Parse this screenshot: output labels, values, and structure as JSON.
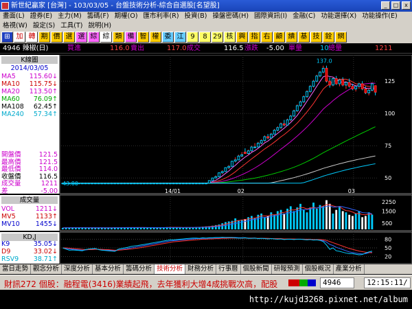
{
  "window": {
    "title": "新世紀贏家 [台灣] - 103/03/05 - 台盤技術分析-綜合自選股[名望股]",
    "min": "_",
    "max": "□",
    "close": "x"
  },
  "menu1": [
    "畫面(L)",
    "證券(E)",
    "主力(M)",
    "籌碼(F)",
    "期權(O)",
    "匯市利率(R)",
    "投資(B)",
    "操盤密碼(H)",
    "國際資訊(I)",
    "金融(C)",
    "功能選擇(X)",
    "功能操作(E)"
  ],
  "menu2": [
    "格視(W)",
    "設定(S)",
    "工具(T)",
    "說明(H)"
  ],
  "toolbar": [
    {
      "t": "⊞",
      "bg": "#2040c0",
      "fg": "#ffffff"
    },
    {
      "t": "加",
      "bg": "#ffffff",
      "fg": "#cc0000"
    },
    {
      "t": "轉",
      "bg": "#ffffff",
      "fg": "#cc0000"
    },
    {
      "t": "期",
      "bg": "#ffcc00",
      "fg": "#000000"
    },
    {
      "t": "價",
      "bg": "#ffcc00",
      "fg": "#000000"
    },
    {
      "t": "選",
      "bg": "#ffcc00",
      "fg": "#000000"
    },
    {
      "t": "選",
      "bg": "#ff66ff",
      "fg": "#000000"
    },
    {
      "t": "綜",
      "bg": "#ff66ff",
      "fg": "#000000"
    },
    {
      "t": "綜",
      "bg": "#ffffff",
      "fg": "#000000"
    },
    {
      "t": "類",
      "bg": "#ffcc00",
      "fg": "#000000"
    },
    {
      "t": "備",
      "bg": "#ff66ff",
      "fg": "#000000"
    },
    {
      "t": "智",
      "bg": "#ffcc00",
      "fg": "#000000"
    },
    {
      "t": "權",
      "bg": "#ffcc00",
      "fg": "#000000"
    },
    {
      "t": "委",
      "bg": "#66ccff",
      "fg": "#000000"
    },
    {
      "t": "江",
      "bg": "#66ccff",
      "fg": "#000000"
    },
    {
      "t": "9",
      "bg": "#ffff66",
      "fg": "#000000"
    },
    {
      "t": "8",
      "bg": "#ffff66",
      "fg": "#000000"
    },
    {
      "t": "29",
      "bg": "#ffff66",
      "fg": "#000000"
    },
    {
      "t": "核",
      "bg": "#ffff66",
      "fg": "#000000"
    },
    {
      "t": "興",
      "bg": "#ffcc00",
      "fg": "#000000"
    },
    {
      "t": "指",
      "bg": "#ffcc00",
      "fg": "#000000"
    },
    {
      "t": "右",
      "bg": "#ffcc00",
      "fg": "#000000"
    },
    {
      "t": "顧",
      "bg": "#ffcc00",
      "fg": "#000000"
    },
    {
      "t": "績",
      "bg": "#ffcc00",
      "fg": "#000000"
    },
    {
      "t": "基",
      "bg": "#ffcc00",
      "fg": "#000000"
    },
    {
      "t": "技",
      "bg": "#ffcc00",
      "fg": "#000000"
    },
    {
      "t": "銓",
      "bg": "#ffcc00",
      "fg": "#000000"
    },
    {
      "t": "網",
      "bg": "#ffcc00",
      "fg": "#000000"
    }
  ],
  "info": {
    "code": "4946 辣椒(日)",
    "buy_label": "買進",
    "buy": "116.0",
    "sell_label": "賣出",
    "sell": "117.0",
    "deal_label": "成交",
    "deal": "116.5",
    "chg_label": "漲跌",
    "chg": "-5.00",
    "vol_label": "單量",
    "vol": "10",
    "total_label": "總量",
    "total": "1211"
  },
  "kpanel": {
    "header": "K線圖",
    "date": "2014/03/05",
    "ma": [
      {
        "n": "MA5",
        "v": "115.60",
        "c": "#cc00cc",
        "a": "↓"
      },
      {
        "n": "MA10",
        "v": "115.75",
        "c": "#cc0000",
        "a": "↓"
      },
      {
        "n": "MA20",
        "v": "113.50",
        "c": "#cc00cc",
        "a": "↑"
      },
      {
        "n": "MA60",
        "v": "76.09",
        "c": "#00aa00",
        "a": "↑"
      },
      {
        "n": "MA108",
        "v": "62.45",
        "c": "#000000",
        "a": "↑"
      },
      {
        "n": "MA240",
        "v": "57.34",
        "c": "#00aacc",
        "a": "↑"
      }
    ],
    "ohlc": [
      {
        "n": "開盤價",
        "v": "121.5",
        "c": "#cc00cc"
      },
      {
        "n": "最高價",
        "v": "121.5",
        "c": "#cc00cc"
      },
      {
        "n": "最低價",
        "v": "114.0",
        "c": "#cc00cc"
      },
      {
        "n": "收盤價",
        "v": "116.5",
        "c": "#000000"
      },
      {
        "n": "成交量",
        "v": "1211",
        "c": "#cc00cc"
      },
      {
        "n": "差",
        "v": "-5.00",
        "c": "#cc00cc"
      }
    ]
  },
  "vpanel": {
    "header": "成交量",
    "rows": [
      {
        "n": "VOL",
        "v": "1211",
        "c": "#cc00cc",
        "a": "↓"
      },
      {
        "n": "MV5",
        "v": "1133",
        "c": "#cc0000",
        "a": "↑"
      },
      {
        "n": "MV10",
        "v": "1455",
        "c": "#0000cc",
        "a": "↓"
      }
    ]
  },
  "kdpanel": {
    "header": "KD,J",
    "rows": [
      {
        "n": "K9",
        "v": "35.05",
        "c": "#0000cc",
        "a": "↓"
      },
      {
        "n": "D9",
        "v": "33.02",
        "c": "#cc0000",
        "a": "↓"
      },
      {
        "n": "RSV9",
        "v": "38.71",
        "c": "#00aacc",
        "a": "↑"
      }
    ]
  },
  "chart_data": {
    "type": "candlestick",
    "price_axis": [
      125,
      100,
      75,
      50
    ],
    "vol_axis": [
      2250,
      1500,
      500
    ],
    "kd_axis": [
      80,
      50,
      20
    ],
    "x_labels": [
      "14/01",
      "02",
      "03"
    ],
    "high_label": "137.0",
    "low_label": "43.80",
    "candles": [
      [
        46,
        46.5,
        45.5,
        46
      ],
      [
        46,
        46.5,
        45.5,
        46
      ],
      [
        46,
        46.5,
        45.5,
        46
      ],
      [
        46,
        46.5,
        45.5,
        46
      ],
      [
        46,
        46.5,
        45.5,
        46
      ],
      [
        46,
        46.5,
        45.5,
        46
      ],
      [
        46,
        46.5,
        45.5,
        46
      ],
      [
        46,
        46.5,
        45.5,
        46
      ],
      [
        46,
        46.5,
        45.5,
        46
      ],
      [
        46,
        46.5,
        45.5,
        46
      ],
      [
        46,
        46.5,
        45.5,
        46
      ],
      [
        46,
        46.5,
        45.5,
        46
      ],
      [
        46,
        46.5,
        45.5,
        46
      ],
      [
        46,
        46.5,
        45.5,
        46
      ],
      [
        46,
        46.5,
        45.5,
        46
      ],
      [
        46,
        46.5,
        45.5,
        46
      ],
      [
        46,
        46.5,
        45.5,
        46
      ],
      [
        46,
        46.5,
        45.5,
        46
      ],
      [
        46,
        46.5,
        45.5,
        46
      ],
      [
        46,
        46.5,
        45.5,
        46
      ],
      [
        46,
        46.5,
        45.5,
        46
      ],
      [
        46,
        46.5,
        45.5,
        46
      ],
      [
        46,
        46.5,
        45.5,
        46
      ],
      [
        46,
        46.5,
        45.5,
        46
      ],
      [
        46,
        46.5,
        45.5,
        46
      ],
      [
        46,
        46.5,
        45.5,
        46
      ],
      [
        46,
        46.5,
        45.5,
        46
      ],
      [
        46,
        46.5,
        45.5,
        46
      ],
      [
        46,
        46.5,
        45.5,
        46
      ],
      [
        46,
        46.5,
        45.5,
        46
      ],
      [
        46,
        46.5,
        45.5,
        46
      ],
      [
        46,
        46.5,
        45.5,
        46
      ],
      [
        46,
        46.5,
        45.5,
        46
      ],
      [
        46,
        46.5,
        45.5,
        46
      ],
      [
        46,
        46.5,
        45.5,
        46
      ],
      [
        46,
        46.5,
        45.5,
        46
      ],
      [
        46,
        46.5,
        45.5,
        46
      ],
      [
        46,
        46.5,
        45.5,
        46
      ],
      [
        46,
        46.5,
        45.5,
        46
      ],
      [
        46,
        46.5,
        45.5,
        46
      ],
      [
        46,
        46.5,
        45.5,
        46
      ],
      [
        46,
        46.5,
        45.5,
        46
      ],
      [
        46,
        46.5,
        45.5,
        46
      ],
      [
        46,
        46.5,
        45.5,
        46
      ],
      [
        46,
        46.5,
        45.5,
        46
      ],
      [
        46,
        48,
        46,
        48
      ],
      [
        48,
        50,
        48,
        50
      ],
      [
        50,
        52,
        50,
        51
      ],
      [
        51,
        54,
        51,
        54
      ],
      [
        54,
        56,
        53,
        55
      ],
      [
        55,
        58,
        55,
        58
      ],
      [
        58,
        60,
        57,
        59
      ],
      [
        59,
        63,
        59,
        63
      ],
      [
        63,
        66,
        62,
        64
      ],
      [
        64,
        68,
        64,
        67
      ],
      [
        67,
        70,
        66,
        68
      ],
      [
        70,
        73,
        69,
        69
      ],
      [
        69,
        72,
        68,
        71
      ],
      [
        71,
        75,
        70,
        74
      ],
      [
        74,
        77,
        73,
        74
      ],
      [
        74,
        78,
        74,
        77
      ],
      [
        77,
        80,
        76,
        79
      ],
      [
        79,
        83,
        78,
        82
      ],
      [
        82,
        84,
        80,
        81
      ],
      [
        81,
        85,
        80,
        84
      ],
      [
        84,
        88,
        84,
        87
      ],
      [
        87,
        90,
        86,
        89
      ],
      [
        89,
        93,
        88,
        92
      ],
      [
        92,
        95,
        90,
        91
      ],
      [
        91,
        96,
        91,
        95
      ],
      [
        95,
        99,
        94,
        98
      ],
      [
        98,
        103,
        97,
        102
      ],
      [
        102,
        107,
        101,
        106
      ],
      [
        106,
        110,
        105,
        109
      ],
      [
        109,
        114,
        108,
        113
      ],
      [
        113,
        118,
        112,
        117
      ],
      [
        117,
        122,
        116,
        121
      ],
      [
        121,
        126,
        120,
        125
      ],
      [
        125,
        130,
        124,
        129
      ],
      [
        129,
        133,
        128,
        132
      ],
      [
        132,
        137,
        131,
        135
      ],
      [
        135,
        137,
        124,
        125
      ],
      [
        125,
        128,
        120,
        122
      ],
      [
        122,
        128,
        121,
        127
      ],
      [
        127,
        129,
        122,
        123
      ],
      [
        123,
        127,
        121,
        126
      ],
      [
        126,
        128,
        121,
        122
      ],
      [
        122,
        125,
        119,
        124
      ],
      [
        124,
        127,
        120,
        121
      ],
      [
        121,
        123,
        118,
        119
      ],
      [
        119,
        122,
        117,
        121
      ],
      [
        121,
        124,
        119,
        123
      ],
      [
        123,
        125,
        118,
        119
      ],
      [
        119,
        121,
        115,
        116
      ],
      [
        116,
        119,
        114,
        118
      ],
      [
        118,
        124,
        117,
        123
      ],
      [
        121.5,
        121.5,
        114,
        116.5
      ]
    ],
    "volumes": [
      120,
      150,
      130,
      140,
      120,
      160,
      140,
      120,
      110,
      130,
      140,
      150,
      120,
      110,
      130,
      140,
      160,
      150,
      140,
      130,
      150,
      170,
      160,
      140,
      130,
      150,
      140,
      130,
      120,
      140,
      150,
      160,
      180,
      170,
      160,
      150,
      140,
      130,
      150,
      160,
      170,
      180,
      200,
      220,
      240,
      260,
      300,
      350,
      400,
      500,
      600,
      650,
      700,
      900,
      750,
      800,
      850,
      1000,
      1100,
      900,
      1200,
      1300,
      1000,
      1100,
      1400,
      1200,
      1500,
      1600,
      1300,
      1700,
      1900,
      1500,
      1800,
      2100,
      1600,
      1400,
      1800,
      2200,
      1700,
      2000,
      1900,
      2400,
      2100,
      1300,
      1600,
      1900,
      1500,
      1400,
      1200,
      1100,
      1300,
      1500,
      1000,
      1100,
      1400,
      1211
    ],
    "k9": [
      50,
      48,
      46,
      45,
      44,
      43,
      42,
      43,
      44,
      45,
      46,
      45,
      44,
      43,
      42,
      41,
      40,
      42,
      44,
      46,
      48,
      50,
      52,
      54,
      56,
      58,
      60,
      62,
      64,
      66,
      68,
      70,
      72,
      74,
      75,
      76,
      77,
      78,
      79,
      80,
      81,
      82,
      82,
      83,
      83,
      84,
      84,
      85,
      85,
      86,
      86,
      86,
      86,
      86,
      85,
      85,
      85,
      84,
      84,
      84,
      83,
      83,
      83,
      82,
      82,
      82,
      81,
      81,
      80,
      80,
      80,
      80,
      80,
      80,
      80,
      79,
      79,
      78,
      78,
      77,
      75,
      70,
      62,
      58,
      52,
      48,
      44,
      40,
      36,
      34,
      32,
      30,
      29,
      30,
      33,
      35.05
    ],
    "d9": [
      50,
      50,
      49,
      48,
      47,
      46,
      45,
      44,
      44,
      44,
      45,
      45,
      45,
      44,
      44,
      43,
      42,
      42,
      43,
      44,
      45,
      46,
      48,
      49,
      51,
      53,
      55,
      57,
      59,
      61,
      63,
      65,
      67,
      69,
      71,
      72,
      73,
      74,
      75,
      76,
      77,
      78,
      79,
      80,
      80,
      81,
      81,
      82,
      82,
      83,
      83,
      84,
      84,
      84,
      84,
      84,
      84,
      84,
      84,
      84,
      83,
      83,
      83,
      83,
      82,
      82,
      82,
      82,
      81,
      81,
      81,
      81,
      80,
      80,
      80,
      80,
      80,
      79,
      79,
      79,
      78,
      76,
      72,
      68,
      64,
      60,
      56,
      52,
      48,
      45,
      42,
      39,
      37,
      35,
      34,
      33.02
    ],
    "rsv9": [
      50,
      46,
      42,
      43,
      42,
      41,
      40,
      44,
      46,
      47,
      48,
      44,
      42,
      41,
      40,
      39,
      38,
      45,
      48,
      50,
      52,
      55,
      57,
      58,
      60,
      62,
      64,
      66,
      68,
      70,
      72,
      74,
      76,
      78,
      78,
      79,
      80,
      81,
      82,
      83,
      84,
      84,
      83,
      85,
      84,
      85,
      85,
      86,
      86,
      87,
      86,
      86,
      86,
      85,
      84,
      84,
      85,
      83,
      83,
      84,
      82,
      83,
      82,
      81,
      82,
      81,
      80,
      81,
      79,
      80,
      80,
      79,
      80,
      80,
      79,
      78,
      79,
      77,
      78,
      76,
      72,
      60,
      45,
      50,
      40,
      38,
      35,
      32,
      30,
      30,
      28,
      26,
      27,
      32,
      36,
      38.71
    ]
  },
  "tabs": [
    "當日走勢",
    "觀念分析",
    "深度分析",
    "基本分析",
    "籌碼分析",
    "技術分析",
    "財務分析",
    "行事曆",
    "個股新聞",
    "研報預測",
    "個股概況",
    "產業分析"
  ],
  "active_tab": 5,
  "ticker": {
    "text": "財訊272 個股：融程電(3416)業績起飛，去年獲利大增4成挑戰次高，配股",
    "code": "4946",
    "time": "12:15:11/"
  },
  "url": "http://kujd3268.pixnet.net/album"
}
